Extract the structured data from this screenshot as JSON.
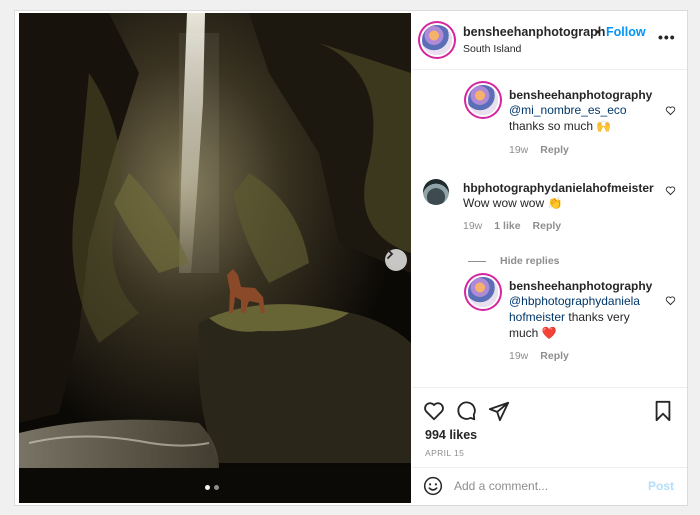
{
  "header": {
    "username": "bensheehanphotograph",
    "separator": "•",
    "follow_label": "Follow",
    "location": "South Island",
    "more_icon": "more-horizontal-icon"
  },
  "carousel": {
    "next_icon": "chevron-right-icon",
    "slide_count": 2,
    "active_slide": 1
  },
  "comments": [
    {
      "username": "bensheehanphotography",
      "mention": "@mi_nombre_es_eco",
      "text": "thanks so much 🙌",
      "age": "19w",
      "reply_label": "Reply"
    },
    {
      "username": "hbphotographydanielahofmeister",
      "text": "Wow wow wow 👏",
      "age": "19w",
      "likes": "1 like",
      "reply_label": "Reply"
    },
    {
      "username": "bensheehanphotography",
      "mention_line1": "@hbphotographydaniela",
      "mention_line2": "hofmeister",
      "text_line2": " thanks very",
      "text_line3": "much ❤️",
      "age": "19w",
      "reply_label": "Reply"
    }
  ],
  "hide_replies_label": "Hide replies",
  "footer": {
    "likes": "994 likes",
    "date": "APRIL 15",
    "comment_placeholder": "Add a comment...",
    "post_label": "Post"
  },
  "colors": {
    "follow_blue": "#0095f6",
    "post_disabled": "#b2dffc",
    "mention_blue": "#00376b",
    "heart_red": "#ed4956"
  }
}
